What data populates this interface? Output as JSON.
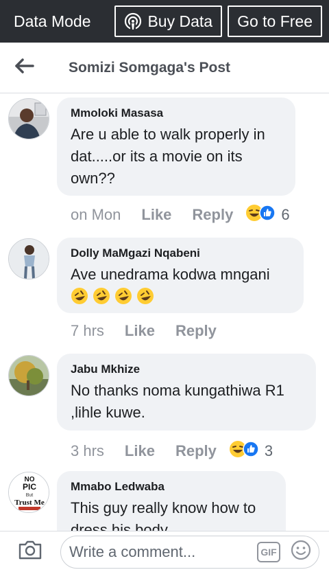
{
  "topbar": {
    "mode_label": "Data Mode",
    "buy_data_label": "Buy Data",
    "go_free_label": "Go to Free"
  },
  "header": {
    "title": "Somizi Somgaga's Post"
  },
  "comments": [
    {
      "author": "Mmoloki Masasa",
      "text": "Are u able to walk properly in dat.....or its a movie on its own??",
      "time": "on Mon",
      "like_label": "Like",
      "reply_label": "Reply",
      "reaction_count": "6",
      "reactions": [
        "laughing-emoji",
        "like-thumb"
      ]
    },
    {
      "author": "Dolly MaMgazi Nqabeni",
      "text": "Ave unedrama kodwa mngani",
      "emojis": [
        "rofl-emoji",
        "rofl-emoji",
        "rofl-emoji",
        "rofl-emoji"
      ],
      "time": "7 hrs",
      "like_label": "Like",
      "reply_label": "Reply"
    },
    {
      "author": "Jabu Mkhize",
      "text": "No thanks noma kungathiwa R1 ,lihle kuwe.",
      "time": "3 hrs",
      "like_label": "Like",
      "reply_label": "Reply",
      "reaction_count": "3",
      "reactions": [
        "laughing-emoji",
        "like-thumb"
      ]
    },
    {
      "author": "Mmabo Ledwaba",
      "text": "This guy really know how to dress his body",
      "avatar_text": [
        "NO",
        "PIC",
        "But",
        "Trust Me"
      ]
    }
  ],
  "composer": {
    "placeholder": "Write a comment...",
    "gif_label": "GIF"
  },
  "colors": {
    "topbar_bg": "#2b2e33",
    "bubble_bg": "#f0f2f5",
    "like_blue": "#1877f2",
    "emoji_yellow": "#ffcc33"
  }
}
